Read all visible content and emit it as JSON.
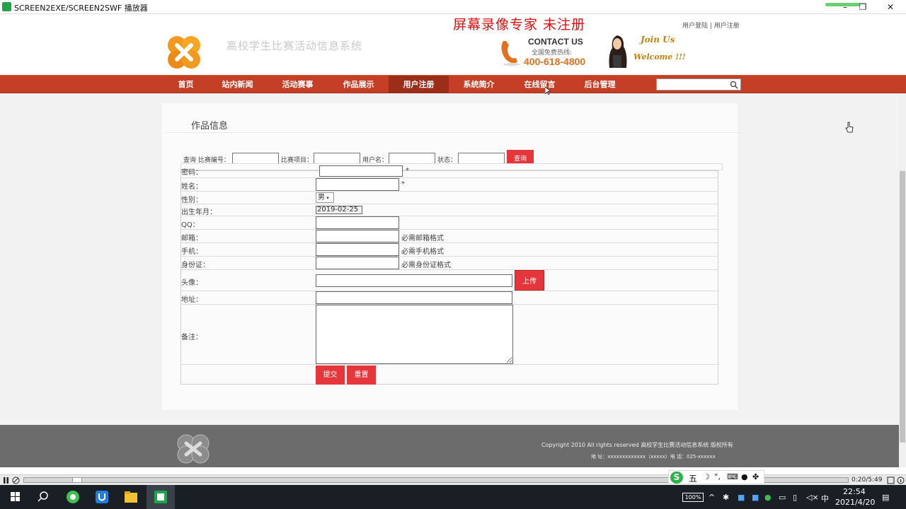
{
  "player": {
    "title": "SCREEN2EXE/SCREEN2SWF 播放器",
    "watermark": "屏幕录像专家  未注册",
    "time_readout": "0:20/5:49",
    "progress": 0.06
  },
  "header": {
    "site_name": "高校学生比赛活动信息系统",
    "contact_title": "CONTACT US",
    "contact_sub": "全国免费热线:",
    "contact_phone": "400-618-4800",
    "join_us": "Join Us",
    "welcome": "Welcome !!!",
    "toplinks": "用户登陆 | 用户注册"
  },
  "nav": {
    "items": [
      "首页",
      "站内新闻",
      "活动赛事",
      "作品展示",
      "用户注册",
      "系统简介",
      "在线留言",
      "后台管理"
    ],
    "active_index": 4,
    "search_value": ""
  },
  "page": {
    "title": "作品信息",
    "query": {
      "label_prefix": "查询 比赛编号：",
      "label_project": "比赛项目：",
      "label_username": "用户名：",
      "label_status": "状态：",
      "button": "查询"
    }
  },
  "form": {
    "partial_label": "密码：",
    "name_label": "姓名：",
    "gender_label": "性别：",
    "gender_value": "男",
    "birth_label": "出生年月：",
    "birth_value": "2019-02-25",
    "qq_label": "QQ：",
    "email_label": "邮箱：",
    "email_hint": "必需邮箱格式",
    "phone_label": "手机：",
    "phone_hint": "必需手机格式",
    "id_label": "身份证：",
    "id_hint": "必需身份证格式",
    "avatar_label": "头像：",
    "upload_button": "上传",
    "address_label": "地址：",
    "note_label": "备注：",
    "submit_button": "提交",
    "reset_button": "重置",
    "required_mark": "*"
  },
  "footer": {
    "copyright": "Copyright 2010 All rights reserved 高校学生比赛活动信息系统 版权所有",
    "address": "地  址：xxxxxxxxxxxxx（xxxxx）电  话：025-xxxxxx"
  },
  "ime": {
    "mode": "五"
  },
  "taskbar": {
    "battery": "100%",
    "lang": "中",
    "time": "22:54",
    "date": "2021/4/20"
  },
  "colors": {
    "nav": "#c43f25",
    "accent_button": "#e5363b",
    "footer": "#6c6c6c",
    "contact_phone": "#e2701c"
  }
}
